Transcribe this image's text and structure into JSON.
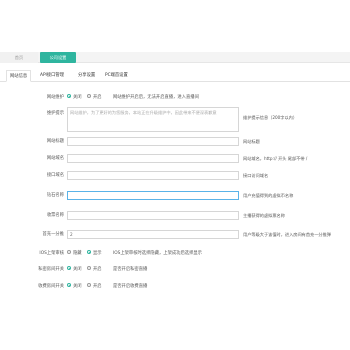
{
  "breadcrumbs": [
    "首页",
    "公司设置"
  ],
  "tabs": [
    "网站信息",
    "API接口管理",
    "分享设置",
    "PC端首设置"
  ],
  "site_maintenance": {
    "label": "网站维护",
    "options": [
      "关闭",
      "开启"
    ],
    "selected": "关闭",
    "hint": "网站维护开启后，无法开启直播，进入直播间"
  },
  "maintenance_notice": {
    "label": "维护提示",
    "placeholder": "网站维护，为了更好的为您服务，本站正在升级维护中，因此带来不便深表歉意",
    "aside": "维护提示信息（200字以内）"
  },
  "site_title": {
    "label": "网站标题",
    "value": "",
    "aside": "网站标题"
  },
  "site_domain": {
    "label": "网站域名",
    "value": "",
    "aside": "网站域名，http:// 开头 尾部不带 /"
  },
  "api_domain": {
    "label": "接口域名",
    "value": "",
    "aside": "接口访问域名"
  },
  "coin_name": {
    "label": "钻石名称",
    "value": "",
    "aside": "用户充值得到的虚拟币名称"
  },
  "vote_name": {
    "label": "收票名称",
    "value": "",
    "aside": "主播获得的虚拟票名称"
  },
  "guard_popup": {
    "label": "首充一分推",
    "value": "2",
    "aside": "用户等级大于该值时，进入房间有首充一分推弹"
  },
  "ios_review": {
    "label": "IOS上架审核",
    "options": [
      "隐藏",
      "显示"
    ],
    "selected": "显示",
    "hint": "IOS上架审核时选择隐藏，上架成功后选择显示"
  },
  "private_live": {
    "label": "私密房间开关",
    "options": [
      "关闭",
      "开启"
    ],
    "selected": "关闭",
    "hint": "是否开启私密直播"
  },
  "paid_live": {
    "label": "收费房间开关",
    "options": [
      "关闭",
      "开启"
    ],
    "selected": "关闭",
    "hint": "是否开启收费直播"
  }
}
